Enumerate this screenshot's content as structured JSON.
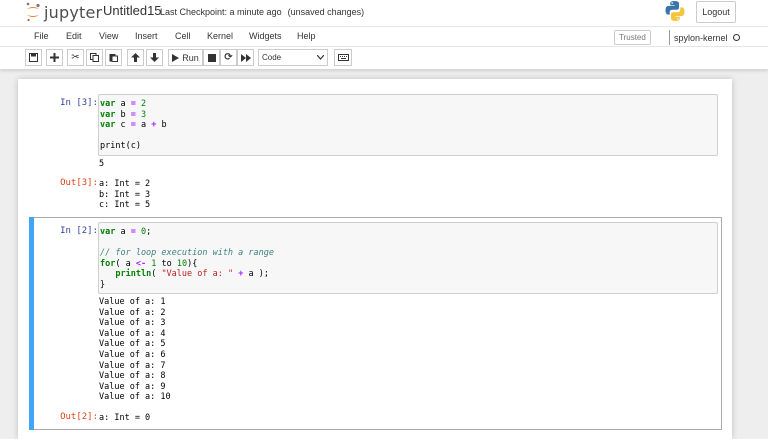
{
  "header": {
    "logo_text": "jupyter",
    "notebook_name": "Untitled15",
    "last_checkpoint": "Last Checkpoint: a minute ago",
    "unsaved": "(unsaved changes)",
    "logout_label": "Logout"
  },
  "menubar": {
    "items": [
      "File",
      "Edit",
      "View",
      "Insert",
      "Cell",
      "Kernel",
      "Widgets",
      "Help"
    ],
    "trusted_label": "Trusted",
    "kernel_name": "spylon-kernel"
  },
  "toolbar": {
    "run_label": "Run",
    "cell_type": "Code"
  },
  "cells": [
    {
      "in_prompt": "In [3]:",
      "code_lines": [
        "var a = 2",
        "var b = 3",
        "var c = a + b",
        "",
        "print(c)"
      ],
      "stdout": [
        "5"
      ],
      "out_prompt": "Out[3]:",
      "result": [
        "a: Int = 2",
        "b: Int = 3",
        "c: Int = 5"
      ]
    },
    {
      "in_prompt": "In [2]:",
      "code_lines": [
        "var a = 0;",
        "",
        "// for loop execution with a range",
        "for( a <- 1 to 10){",
        "   println( \"Value of a: \" + a );",
        "}"
      ],
      "stdout": [
        "Value of a: 1",
        "Value of a: 2",
        "Value of a: 3",
        "Value of a: 4",
        "Value of a: 5",
        "Value of a: 6",
        "Value of a: 7",
        "Value of a: 8",
        "Value of a: 9",
        "Value of a: 10"
      ],
      "out_prompt": "Out[2]:",
      "result": [
        "a: Int = 0"
      ]
    }
  ],
  "colors": {
    "in_prompt": "#303f9f",
    "out_prompt": "#d84315",
    "selected_bar": "#42a5f5",
    "logo_orange": "#f37726"
  }
}
